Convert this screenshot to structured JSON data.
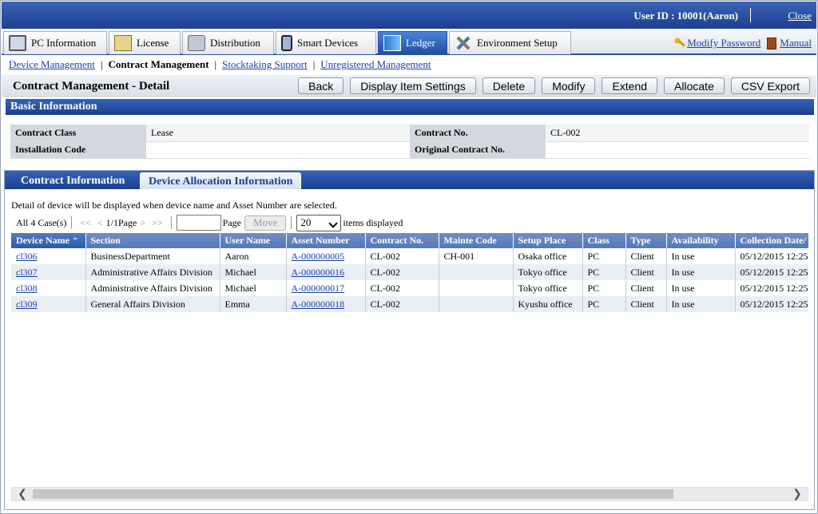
{
  "header": {
    "user_label": "User ID : 10001(Aaron)",
    "close": "Close"
  },
  "main_tabs": [
    {
      "label": "PC Information",
      "icon": "pc-icon"
    },
    {
      "label": "License",
      "icon": "license-icon"
    },
    {
      "label": "Distribution",
      "icon": "distribution-icon"
    },
    {
      "label": "Smart Devices",
      "icon": "smartphone-icon"
    },
    {
      "label": "Ledger",
      "icon": "ledger-icon",
      "active": true
    },
    {
      "label": "Environment Setup",
      "icon": "tools-icon"
    }
  ],
  "right_links": {
    "modify_password": "Modify Password",
    "manual": "Manual"
  },
  "subnav": {
    "device_mgmt": "Device Management",
    "contract_mgmt": "Contract Management",
    "stocktaking": "Stocktaking Support",
    "unregistered": "Unregistered Management"
  },
  "page": {
    "title": "Contract Management - Detail"
  },
  "buttons": {
    "back": "Back",
    "display_item": "Display Item Settings",
    "delete": "Delete",
    "modify": "Modify",
    "extend": "Extend",
    "allocate": "Allocate",
    "csv": "CSV Export"
  },
  "basic": {
    "section_title": "Basic Information",
    "contract_class_label": "Contract Class",
    "contract_class_value": "Lease",
    "contract_no_label": "Contract No.",
    "contract_no_value": "CL-002",
    "installation_code_label": "Installation Code",
    "installation_code_value": "",
    "original_contract_label": "Original Contract No.",
    "original_contract_value": ""
  },
  "inner_tabs": {
    "contract_info": "Contract Information",
    "device_alloc": "Device Allocation Information"
  },
  "note": "Detail of device will be displayed when device name and Asset Number are selected.",
  "pager": {
    "count": "All 4 Case(s)",
    "first": "<<",
    "prev": "<",
    "page_info": "1/1Page",
    "next": ">",
    "last": ">>",
    "page_label": "Page",
    "move": "Move",
    "per_page": "20",
    "items_label": "items displayed",
    "page_input": ""
  },
  "table": {
    "columns": [
      "Device Name",
      "Section",
      "User Name",
      "Asset Number",
      "Contract No.",
      "Mainte Code",
      "Setup Place",
      "Class",
      "Type",
      "Availability",
      "Collection Date/"
    ],
    "rows": [
      [
        "cl306",
        "BusinessDepartment",
        "Aaron",
        "A-000000005",
        "CL-002",
        "CH-001",
        "Osaka office",
        "PC",
        "Client",
        "In use",
        "05/12/2015 12:25:"
      ],
      [
        "cl307",
        "Administrative Affairs Division",
        "Michael",
        "A-000000016",
        "CL-002",
        "",
        "Tokyo office",
        "PC",
        "Client",
        "In use",
        "05/12/2015 12:25:"
      ],
      [
        "cl308",
        "Administrative Affairs Division",
        "Michael",
        "A-000000017",
        "CL-002",
        "",
        "Tokyo office",
        "PC",
        "Client",
        "In use",
        "05/12/2015 12:25:"
      ],
      [
        "cl309",
        "General Affairs Division",
        "Emma",
        "A-000000018",
        "CL-002",
        "",
        "Kyushu office",
        "PC",
        "Client",
        "In use",
        "05/12/2015 12:25:"
      ]
    ]
  },
  "colors": {
    "header_blue": "#1d3f8f",
    "link": "#1a3fb0",
    "table_header": "#5579b5"
  }
}
